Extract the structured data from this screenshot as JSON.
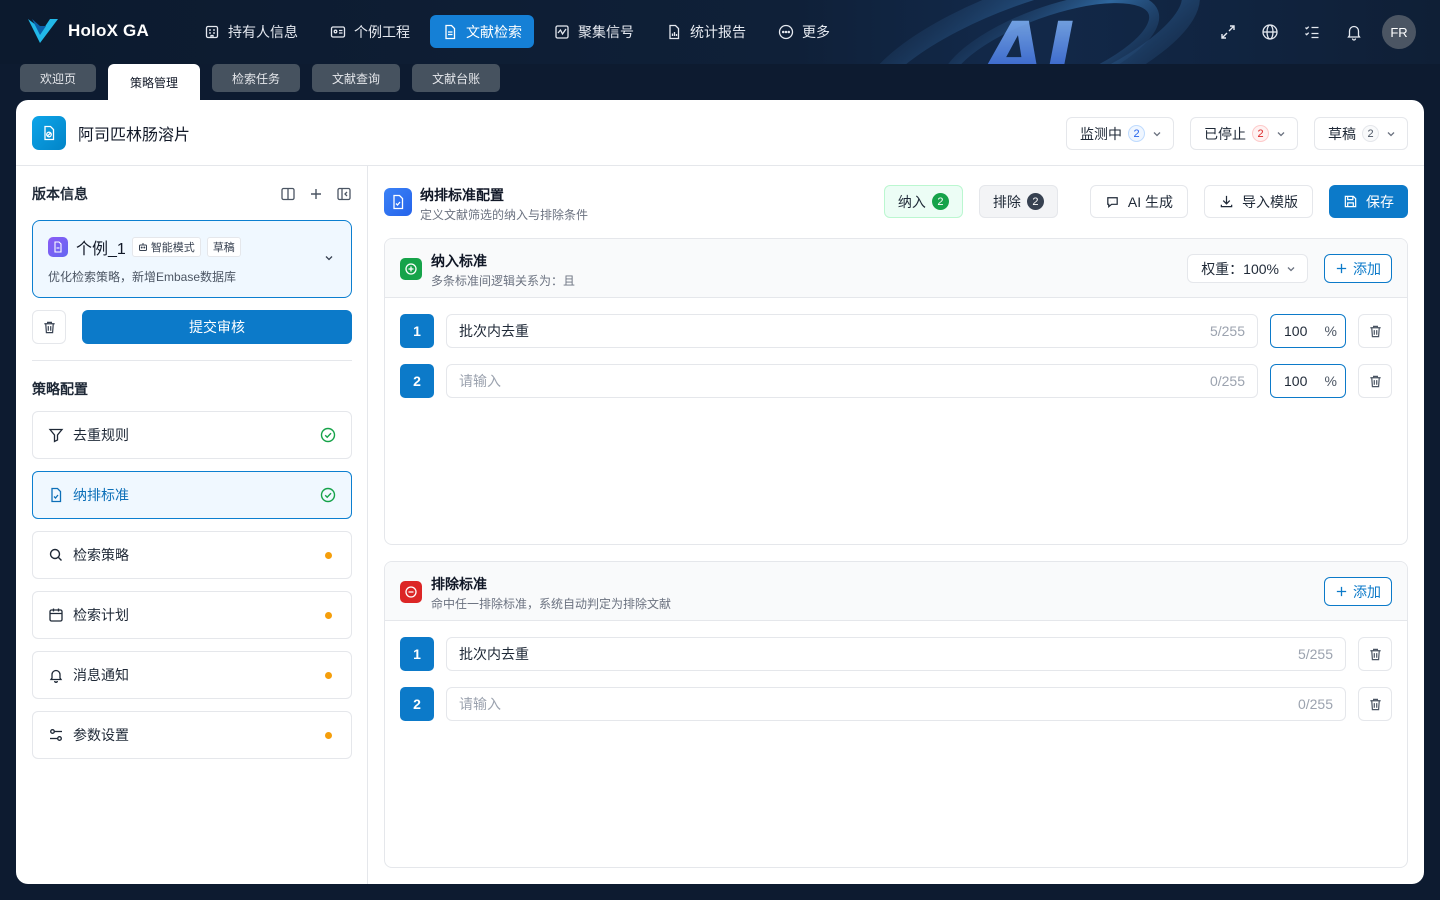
{
  "brand": {
    "name": "HoloX GA"
  },
  "nav": [
    {
      "label": "持有人信息",
      "icon": "building-icon"
    },
    {
      "label": "个例工程",
      "icon": "id-card-icon"
    },
    {
      "label": "文献检索",
      "icon": "document-icon",
      "active": true
    },
    {
      "label": "聚集信号",
      "icon": "signal-icon"
    },
    {
      "label": "统计报告",
      "icon": "report-icon"
    },
    {
      "label": "更多",
      "icon": "more-icon"
    }
  ],
  "user": {
    "initials": "FR"
  },
  "tabs": [
    "欢迎页",
    "策略管理",
    "检索任务",
    "文献查询",
    "文献台账"
  ],
  "header": {
    "product_title": "阿司匹林肠溶片",
    "status": [
      {
        "label": "监测中",
        "count": "2"
      },
      {
        "label": "已停止",
        "count": "2"
      },
      {
        "label": "草稿",
        "count": "2"
      }
    ]
  },
  "left": {
    "version_title": "版本信息",
    "version": {
      "name": "个例_1",
      "mode_badge": "智能模式",
      "state_badge": "草稿",
      "desc": "优化检索策略，新增Embase数据库"
    },
    "submit_label": "提交审核",
    "strategy_title": "策略配置",
    "strategy_items": [
      {
        "label": "去重规则",
        "state": "done"
      },
      {
        "label": "纳排标准",
        "state": "done"
      },
      {
        "label": "检索策略",
        "state": "pending"
      },
      {
        "label": "检索计划",
        "state": "pending"
      },
      {
        "label": "消息通知",
        "state": "pending"
      },
      {
        "label": "参数设置",
        "state": "pending"
      }
    ]
  },
  "config": {
    "title": "纳排标准配置",
    "subtitle": "定义文献筛选的纳入与排除条件",
    "include_pill": {
      "label": "纳入",
      "count": "2"
    },
    "exclude_pill": {
      "label": "排除",
      "count": "2"
    },
    "ai_label": "AI 生成",
    "import_label": "导入模版",
    "save_label": "保存"
  },
  "include": {
    "title": "纳入标准",
    "subtitle": "多条标准间逻辑关系为：且",
    "weight_label": "权重：100%",
    "add_label": "添加",
    "rows": [
      {
        "index": "1",
        "value": "批次内去重",
        "placeholder": "",
        "count": "5/255",
        "weight": "100",
        "unit": "%"
      },
      {
        "index": "2",
        "value": "",
        "placeholder": "请输入",
        "count": "0/255",
        "weight": "100",
        "unit": "%"
      }
    ]
  },
  "exclude": {
    "title": "排除标准",
    "subtitle": "命中任一排除标准，系统自动判定为排除文献",
    "add_label": "添加",
    "rows": [
      {
        "index": "1",
        "value": "批次内去重",
        "placeholder": "",
        "count": "5/255"
      },
      {
        "index": "2",
        "value": "",
        "placeholder": "请输入",
        "count": "0/255"
      }
    ]
  },
  "colors": {
    "primary": "#0c7ac9",
    "nav_bg": "#0c1a2e",
    "success": "#16a34a",
    "danger": "#dc2626",
    "warning": "#f59e0b"
  }
}
